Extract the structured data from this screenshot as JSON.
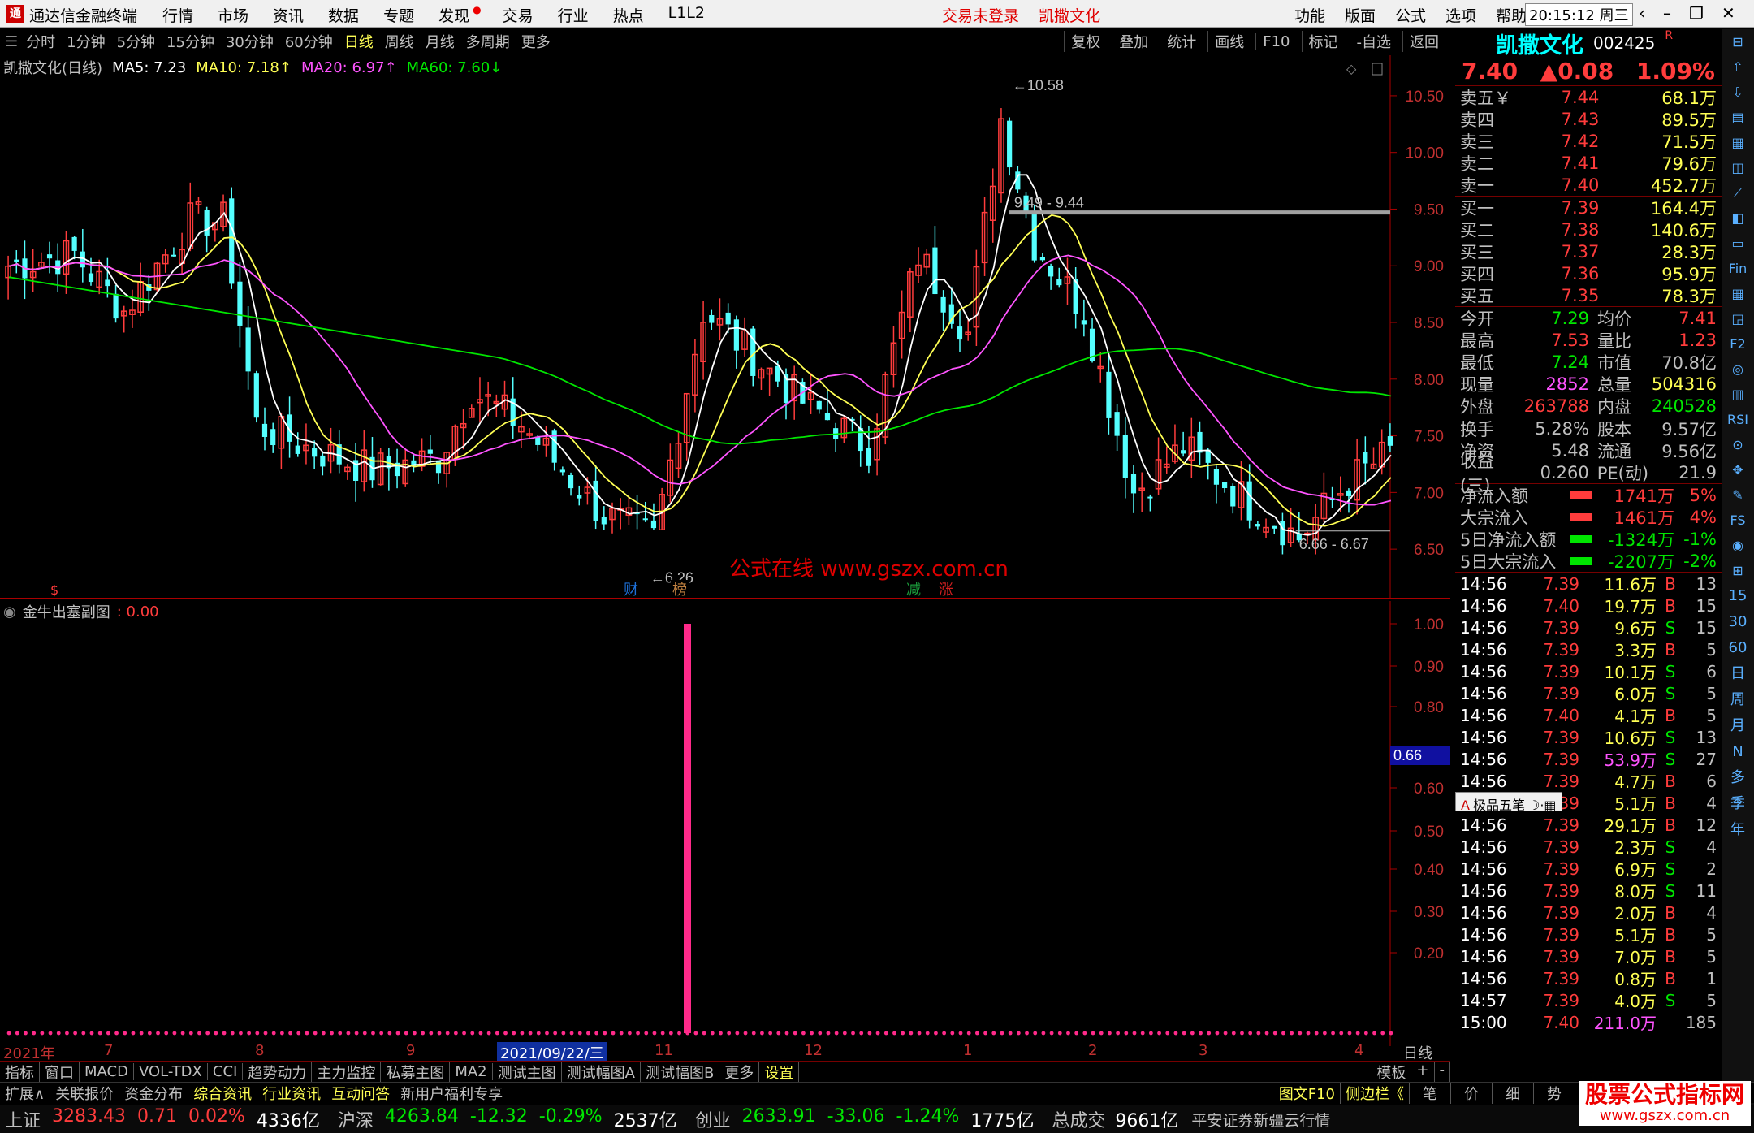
{
  "window": {
    "app_title": "通达信金融终端",
    "menu": [
      "行情",
      "市场",
      "资讯",
      "数据",
      "专题",
      "发现",
      "交易",
      "行业",
      "热点",
      "L1L2"
    ],
    "center_notice": "交易未登录",
    "center_stock": "凯撒文化",
    "right_menu": [
      "功能",
      "版面",
      "公式",
      "选项",
      "帮助"
    ],
    "time": "20:15:12",
    "weekday": "周三"
  },
  "period_tabs": [
    "分时",
    "1分钟",
    "5分钟",
    "15分钟",
    "30分钟",
    "60分钟",
    "日线",
    "周线",
    "月线",
    "多周期",
    "更多"
  ],
  "active_period": "日线",
  "tools": [
    "复权",
    "叠加",
    "统计",
    "画线",
    "F10",
    "标记",
    "-自选",
    "返回"
  ],
  "chart_header": {
    "stock_label": "凯撒文化(日线)",
    "ma5": "MA5: 7.23",
    "ma10": "MA10: 7.18",
    "ma20": "MA20: 6.97",
    "ma60": "MA60: 7.60"
  },
  "price_axis": [
    "10.50",
    "10.00",
    "9.50",
    "9.00",
    "8.50",
    "8.00",
    "7.50",
    "7.00",
    "6.50"
  ],
  "annotations": {
    "high": "10.58",
    "resist": "9.49 - 9.44",
    "support": "6.66 - 6.67",
    "low": "6.26",
    "watermark": "公式在线  www.gszx.com.cn",
    "badges": [
      "财",
      "榜",
      "减",
      "涨"
    ]
  },
  "indicator": {
    "title": "金牛出塞副图",
    "value": "0.00",
    "axis": [
      "1.00",
      "0.90",
      "0.80",
      "0.60",
      "0.50",
      "0.40",
      "0.30",
      "0.20"
    ],
    "cursor_label": "0.66"
  },
  "time_axis": [
    "2021年",
    "7",
    "8",
    "9",
    "2021/09/22/三",
    "11",
    "12",
    "1",
    "2",
    "3",
    "4"
  ],
  "time_axis_right": "日线",
  "chart_data": {
    "type": "line",
    "title": "凯撒文化(日线)",
    "x": [
      "2021-07",
      "2021-08",
      "2021-09",
      "2021-10",
      "2021-11",
      "2021-12",
      "2022-01",
      "2022-02",
      "2022-03",
      "2022-04"
    ],
    "ylim": [
      6.2,
      10.7
    ],
    "series": [
      {
        "name": "MA5",
        "values": [
          9.1,
          7.4,
          7.3,
          8.6,
          8.1,
          8.3,
          9.4,
          7.3,
          6.8,
          7.23
        ]
      },
      {
        "name": "MA10",
        "values": [
          9.2,
          7.6,
          7.25,
          8.5,
          8.0,
          8.4,
          9.2,
          7.5,
          6.9,
          7.18
        ]
      },
      {
        "name": "MA20",
        "values": [
          9.1,
          7.9,
          7.2,
          8.1,
          7.9,
          8.6,
          8.9,
          7.8,
          7.0,
          6.97
        ]
      },
      {
        "name": "MA60",
        "values": [
          8.9,
          8.5,
          8.0,
          7.4,
          7.6,
          7.8,
          8.3,
          8.3,
          7.9,
          7.6
        ]
      }
    ],
    "indicator_series": {
      "name": "金牛出塞副图",
      "signal_date": "2021-10",
      "value": 1.0
    }
  },
  "bottom_tabs": [
    "指标",
    "窗口",
    "MACD",
    "VOL-TDX",
    "CCI",
    "趋势动力",
    "主力监控",
    "私募主图",
    "MA2",
    "测试主图",
    "测试幅图A",
    "测试幅图B",
    "更多",
    "设置"
  ],
  "bottom_right": [
    "模板",
    "+",
    "-"
  ],
  "info_tabs": [
    "扩展∧",
    "关联报价",
    "资金分布",
    "综合资讯",
    "行业资讯",
    "互动问答",
    "新用户福利专享"
  ],
  "info_right": [
    "图文F10",
    "侧边栏《",
    "笔",
    "价",
    "细",
    "势"
  ],
  "quote": {
    "name": "凯撒文化",
    "code": "002425",
    "flag": "R",
    "price": "7.40",
    "change": "▲0.08",
    "pct": "1.09%",
    "asks": [
      {
        "label": "卖五￥",
        "price": "7.44",
        "vol": "68.1万"
      },
      {
        "label": "卖四",
        "price": "7.43",
        "vol": "89.5万"
      },
      {
        "label": "卖三",
        "price": "7.42",
        "vol": "71.5万"
      },
      {
        "label": "卖二",
        "price": "7.41",
        "vol": "79.6万"
      },
      {
        "label": "卖一",
        "price": "7.40",
        "vol": "452.7万"
      }
    ],
    "bids": [
      {
        "label": "买一",
        "price": "7.39",
        "vol": "164.4万"
      },
      {
        "label": "买二",
        "price": "7.38",
        "vol": "140.6万"
      },
      {
        "label": "买三",
        "price": "7.37",
        "vol": "28.3万"
      },
      {
        "label": "买四",
        "price": "7.36",
        "vol": "95.9万"
      },
      {
        "label": "买五",
        "price": "7.35",
        "vol": "78.3万"
      }
    ],
    "stats": [
      {
        "l1": "今开",
        "v1": "7.29",
        "l2": "均价",
        "v2": "7.41"
      },
      {
        "l1": "最高",
        "v1": "7.53",
        "l2": "量比",
        "v2": "1.23"
      },
      {
        "l1": "最低",
        "v1": "7.24",
        "l2": "市值",
        "v2": "70.8亿"
      },
      {
        "l1": "现量",
        "v1": "2852",
        "l2": "总量",
        "v2": "504316"
      },
      {
        "l1": "外盘",
        "v1": "263788",
        "l2": "内盘",
        "v2": "240528"
      }
    ],
    "stats2": [
      {
        "l1": "换手",
        "v1": "5.28%",
        "l2": "股本",
        "v2": "9.57亿"
      },
      {
        "l1": "净资",
        "v1": "5.48",
        "l2": "流通",
        "v2": "9.56亿"
      },
      {
        "l1": "收益(三)",
        "v1": "0.260",
        "l2": "PE(动)",
        "v2": "21.9"
      }
    ],
    "flows": [
      {
        "label": "净流入额",
        "value": "1741万",
        "pct": "5%",
        "dir": "up"
      },
      {
        "label": "大宗流入",
        "value": "1461万",
        "pct": "4%",
        "dir": "up"
      },
      {
        "label": "5日净流入额",
        "value": "-1324万",
        "pct": "-1%",
        "dir": "down"
      },
      {
        "label": "5日大宗流入",
        "value": "-2207万",
        "pct": "-2%",
        "dir": "down"
      }
    ],
    "ticks": [
      {
        "t": "14:56",
        "p": "7.39",
        "v": "11.6万",
        "s": "B",
        "n": "13"
      },
      {
        "t": "14:56",
        "p": "7.40",
        "v": "19.7万",
        "s": "B",
        "n": "15"
      },
      {
        "t": "14:56",
        "p": "7.39",
        "v": "9.6万",
        "s": "S",
        "n": "15"
      },
      {
        "t": "14:56",
        "p": "7.39",
        "v": "3.3万",
        "s": "B",
        "n": "5"
      },
      {
        "t": "14:56",
        "p": "7.39",
        "v": "10.1万",
        "s": "S",
        "n": "6"
      },
      {
        "t": "14:56",
        "p": "7.39",
        "v": "6.0万",
        "s": "S",
        "n": "5"
      },
      {
        "t": "14:56",
        "p": "7.40",
        "v": "4.1万",
        "s": "B",
        "n": "5"
      },
      {
        "t": "14:56",
        "p": "7.39",
        "v": "10.6万",
        "s": "S",
        "n": "13"
      },
      {
        "t": "14:56",
        "p": "7.39",
        "v": "53.9万",
        "s": "S",
        "n": "27"
      },
      {
        "t": "14:56",
        "p": "7.39",
        "v": "4.7万",
        "s": "B",
        "n": "6"
      },
      {
        "t": "14:56",
        "p": "7.39",
        "v": "5.1万",
        "s": "B",
        "n": "4"
      },
      {
        "t": "14:56",
        "p": "7.39",
        "v": "29.1万",
        "s": "B",
        "n": "12"
      },
      {
        "t": "14:56",
        "p": "7.39",
        "v": "2.3万",
        "s": "S",
        "n": "4"
      },
      {
        "t": "14:56",
        "p": "7.39",
        "v": "6.9万",
        "s": "S",
        "n": "2"
      },
      {
        "t": "14:56",
        "p": "7.39",
        "v": "8.0万",
        "s": "S",
        "n": "11"
      },
      {
        "t": "14:56",
        "p": "7.39",
        "v": "2.0万",
        "s": "B",
        "n": "4"
      },
      {
        "t": "14:56",
        "p": "7.39",
        "v": "5.1万",
        "s": "B",
        "n": "5"
      },
      {
        "t": "14:56",
        "p": "7.39",
        "v": "7.0万",
        "s": "B",
        "n": "5"
      },
      {
        "t": "14:56",
        "p": "7.39",
        "v": "0.8万",
        "s": "B",
        "n": "1"
      },
      {
        "t": "14:57",
        "p": "7.39",
        "v": "4.0万",
        "s": "S",
        "n": "5"
      },
      {
        "t": "15:00",
        "p": "7.40",
        "v": "211.0万",
        "s": "",
        "n": "185"
      }
    ],
    "ime_bar": "极品五笔"
  },
  "sidebar_labels": [
    "15",
    "30",
    "60",
    "日",
    "周",
    "月",
    "N",
    "多",
    "季",
    "年"
  ],
  "status": [
    {
      "name": "上证",
      "val": "3283.43",
      "chg": "0.71",
      "pct": "0.02%",
      "amt": "4336亿",
      "dir": "up"
    },
    {
      "name": "沪深",
      "val": "4263.84",
      "chg": "-12.32",
      "pct": "-0.29%",
      "amt": "2537亿",
      "dir": "down"
    },
    {
      "name": "创业",
      "val": "2633.91",
      "chg": "-33.06",
      "pct": "-1.24%",
      "amt": "1775亿",
      "dir": "down"
    }
  ],
  "status_total_label": "总成交",
  "status_total": "9661亿",
  "status_broker": "平安证券新疆云行情",
  "brand": "股票公式指标网",
  "brand_url": "www.gszx.com.cn"
}
